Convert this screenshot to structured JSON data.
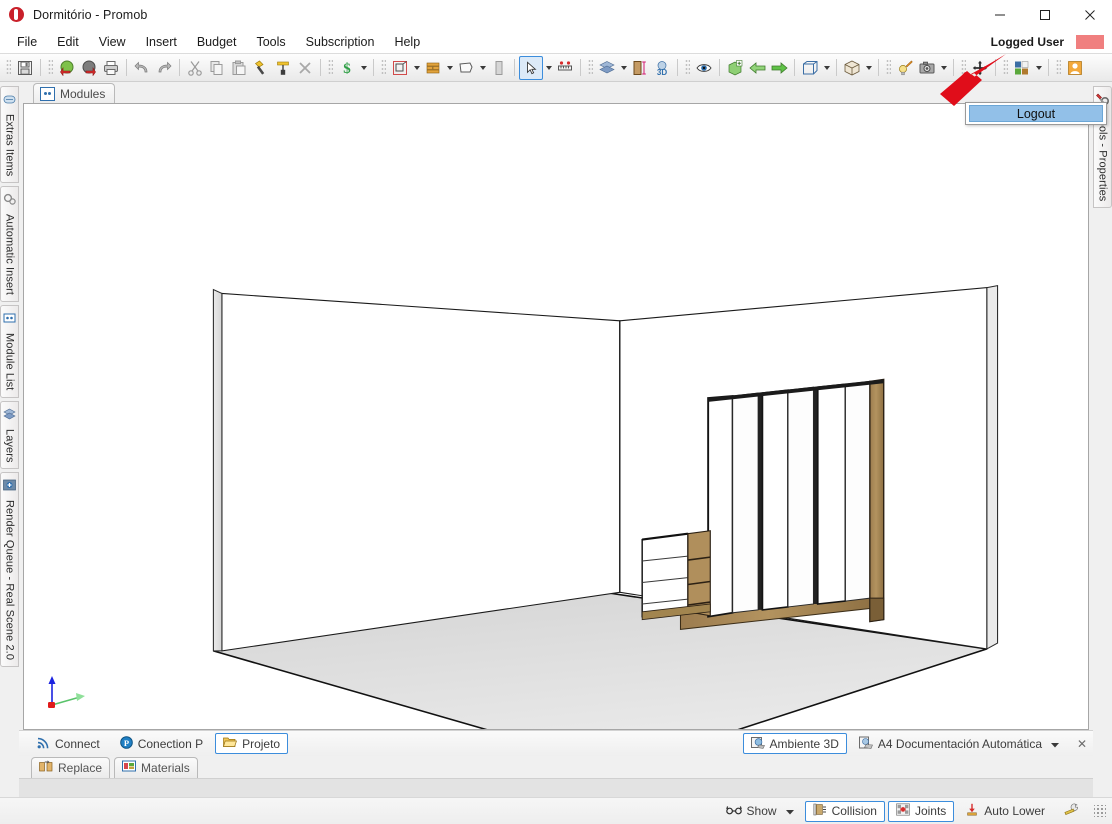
{
  "window": {
    "title": "Dormitório - Promob",
    "app_icon": "promob-logo-icon",
    "minimize_label": "—",
    "maximize_label": "▢",
    "close_label": "✕"
  },
  "menu": {
    "items": [
      {
        "label": "File",
        "name": "menu-file"
      },
      {
        "label": "Edit",
        "name": "menu-edit"
      },
      {
        "label": "View",
        "name": "menu-view"
      },
      {
        "label": "Insert",
        "name": "menu-insert"
      },
      {
        "label": "Budget",
        "name": "menu-budget"
      },
      {
        "label": "Tools",
        "name": "menu-tools"
      },
      {
        "label": "Subscription",
        "name": "menu-subscription"
      },
      {
        "label": "Help",
        "name": "menu-help"
      }
    ],
    "logged_user_label": "Logged User",
    "logged_user_swatch_color": "#f07f7f"
  },
  "logout_popup": {
    "item_label": "Logout",
    "highlight_color": "#92c0e8",
    "visible": true
  },
  "toolbar": {
    "groups": [
      {
        "items": [
          {
            "icon": "save-icon",
            "label": "Save"
          }
        ]
      },
      {
        "items": [
          {
            "icon": "open-project-icon",
            "label": "Open"
          },
          {
            "icon": "close-project-icon",
            "label": "Close"
          },
          {
            "icon": "print-icon",
            "label": "Print"
          }
        ]
      },
      {
        "items": [
          {
            "icon": "undo-icon",
            "label": "Undo"
          },
          {
            "icon": "redo-icon",
            "label": "Redo"
          }
        ]
      },
      {
        "items": [
          {
            "icon": "cut-icon",
            "label": "Cut"
          },
          {
            "icon": "copy-icon",
            "label": "Copy"
          },
          {
            "icon": "paste-icon",
            "label": "Paste"
          },
          {
            "icon": "hammer-icon",
            "label": "Apply"
          },
          {
            "icon": "paint-roller-icon",
            "label": "Paint"
          },
          {
            "icon": "delete-x-icon",
            "label": "Delete"
          }
        ]
      },
      {
        "items": [
          {
            "icon": "dollar-icon",
            "label": "Budget",
            "caret": true
          }
        ]
      },
      {
        "items": [
          {
            "icon": "environment-icon",
            "label": "Environment",
            "caret": true
          },
          {
            "icon": "wall-icon",
            "label": "Wall",
            "caret": true
          },
          {
            "icon": "ceiling-icon",
            "label": "Ceiling",
            "caret": true
          },
          {
            "icon": "door-gray-icon",
            "label": "Opening"
          }
        ]
      },
      {
        "items": [
          {
            "icon": "cursor-arrow-icon",
            "label": "Select",
            "caret": true,
            "selected": true
          },
          {
            "icon": "measure-icon",
            "label": "Measure"
          }
        ]
      },
      {
        "items": [
          {
            "icon": "layers-icon",
            "label": "Layers",
            "caret": true
          },
          {
            "icon": "height-ruler-icon",
            "label": "Height"
          },
          {
            "icon": "3d-view-icon",
            "label": "3D"
          }
        ]
      },
      {
        "items": [
          {
            "icon": "eye-icon",
            "label": "Visibility"
          }
        ]
      },
      {
        "items": [
          {
            "icon": "add-module-icon",
            "label": "Add Module"
          },
          {
            "icon": "arrow-left-green-icon",
            "label": "Previous"
          },
          {
            "icon": "arrow-right-green-icon",
            "label": "Next"
          }
        ]
      },
      {
        "items": [
          {
            "icon": "box-wire-icon",
            "label": "View Mode",
            "caret": true
          }
        ]
      },
      {
        "items": [
          {
            "icon": "cube-icon",
            "label": "Render Mode",
            "caret": true
          }
        ]
      },
      {
        "items": [
          {
            "icon": "light-bulb-icon",
            "label": "Lights"
          },
          {
            "icon": "camera-icon",
            "label": "Camera",
            "caret": true
          }
        ]
      },
      {
        "items": [
          {
            "icon": "move-icon",
            "label": "Move"
          }
        ]
      },
      {
        "items": [
          {
            "icon": "colors-icon",
            "label": "Colors",
            "caret": true
          }
        ]
      },
      {
        "items": [
          {
            "icon": "user-account-icon",
            "label": "Account"
          }
        ]
      }
    ]
  },
  "modules_tab": {
    "label": "Modules",
    "icon": "modules-icon"
  },
  "left_dock": {
    "tabs": [
      {
        "label": "Extras Items",
        "icon": "extras-items-icon"
      },
      {
        "label": "Automatic Insert",
        "icon": "automatic-insert-icon"
      },
      {
        "label": "Module List",
        "icon": "module-list-icon"
      },
      {
        "label": "Layers",
        "icon": "layers-icon"
      },
      {
        "label": "Render Queue - Real Scene 2.0",
        "icon": "render-queue-icon"
      }
    ]
  },
  "right_dock": {
    "tabs": [
      {
        "label": "Tools - Properties",
        "icon": "tools-properties-icon"
      }
    ]
  },
  "viewport": {
    "scene_description": "3D bedroom with white wardrobe, wood side panel and drawer unit",
    "axis_gizmo": {
      "x_color": "#e01b1b",
      "y_color": "#59c36a",
      "z_color": "#1b23e0"
    },
    "background": "#ffffff",
    "floor_color": "#e2e2e2",
    "wall_color": "#ffffff",
    "wood_color": "#a07f52",
    "door_color": "#ffffff"
  },
  "bottom_bar_1": {
    "left_buttons": [
      {
        "label": "Connect",
        "icon": "connect-rss-icon",
        "active": false
      },
      {
        "label": "Conection P",
        "icon": "conection-p-icon",
        "active": false
      },
      {
        "label": "Projeto",
        "icon": "folder-open-icon",
        "active": true
      }
    ],
    "right_buttons": [
      {
        "label": "Ambiente 3D",
        "icon": "ambiente-3d-icon",
        "active": true
      },
      {
        "label": "A4 Documentación Automática",
        "icon": "document-a4-icon",
        "active": false,
        "caret": true
      }
    ],
    "close_label": "✕"
  },
  "bottom_bar_2": {
    "tabs": [
      {
        "label": "Replace",
        "icon": "replace-icon"
      },
      {
        "label": "Materials",
        "icon": "materials-icon"
      }
    ]
  },
  "statusbar": {
    "buttons": [
      {
        "label": "Show",
        "icon": "glasses-icon",
        "caret": true,
        "active": false
      },
      {
        "label": "Collision",
        "icon": "collision-icon",
        "active": true
      },
      {
        "label": "Joints",
        "icon": "joints-icon",
        "active": true
      },
      {
        "label": "Auto Lower",
        "icon": "auto-lower-icon",
        "active": false
      },
      {
        "label": "",
        "icon": "wrench-icon",
        "active": false
      }
    ]
  }
}
